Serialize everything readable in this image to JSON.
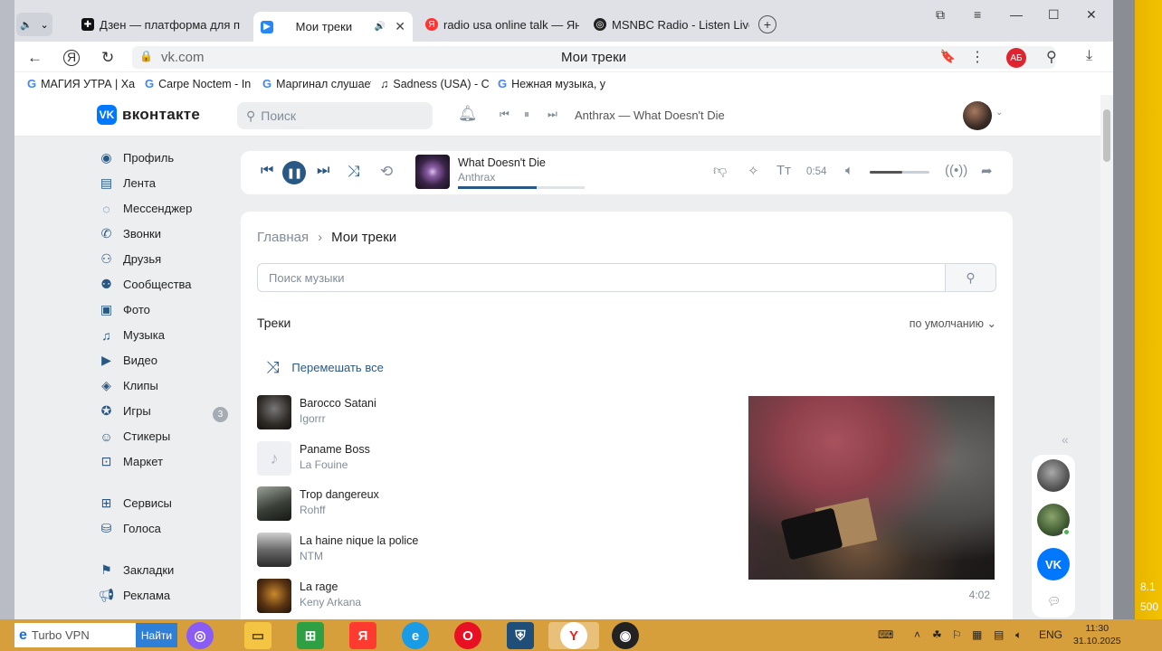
{
  "browser": {
    "tabs": [
      {
        "label": "Дзен — платформа для п",
        "icon": "dzen-icon"
      },
      {
        "label": "Мои треки",
        "icon": "vk-video-icon",
        "active": true
      },
      {
        "label": "radio usa online talk — Янд",
        "icon": "yandex-icon"
      },
      {
        "label": "MSNBC Radio - Listen Live",
        "icon": "msnbc-icon"
      }
    ],
    "url": "vk.com",
    "page_title": "Мои треки",
    "profile_badge": "АБ",
    "bookmarks": [
      "МАГИЯ УТРА | Ха",
      "Carpe Noctem - In",
      "Маргинал слушает",
      "Sadness (USA) - C",
      "Нежная музыка, у"
    ]
  },
  "vk": {
    "logo": "вконтакте",
    "search_placeholder": "Поиск",
    "header_track": "Anthrax — What Doesn't Die",
    "sidebar": [
      {
        "label": "Профиль",
        "icon": "profile-icon"
      },
      {
        "label": "Лента",
        "icon": "feed-icon"
      },
      {
        "label": "Мессенджер",
        "icon": "messenger-icon"
      },
      {
        "label": "Звонки",
        "icon": "phone-icon"
      },
      {
        "label": "Друзья",
        "icon": "friends-icon"
      },
      {
        "label": "Сообщества",
        "icon": "communities-icon"
      },
      {
        "label": "Фото",
        "icon": "photo-icon"
      },
      {
        "label": "Музыка",
        "icon": "music-icon"
      },
      {
        "label": "Видео",
        "icon": "video-icon"
      },
      {
        "label": "Клипы",
        "icon": "clips-icon"
      },
      {
        "label": "Игры",
        "icon": "games-icon"
      },
      {
        "label": "Стикеры",
        "icon": "stickers-icon"
      },
      {
        "label": "Маркет",
        "icon": "market-icon"
      },
      {
        "label": "Сервисы",
        "icon": "services-icon"
      },
      {
        "label": "Голоса",
        "icon": "voices-icon"
      },
      {
        "label": "Закладки",
        "icon": "bookmark-icon"
      },
      {
        "label": "Реклама",
        "icon": "ads-icon"
      }
    ],
    "games_badge": "3",
    "player": {
      "title": "What Doesn't Die",
      "artist": "Anthrax",
      "time": "0:54",
      "progress": 0.62,
      "volume": 0.55
    },
    "breadcrumb": {
      "home": "Главная",
      "current": "Мои треки"
    },
    "music_search_placeholder": "Поиск музыки",
    "section_title": "Треки",
    "sort_label": "по умолчанию",
    "shuffle_label": "Перемешать все",
    "tracks": [
      {
        "title": "Barocco Satani",
        "artist": "Igorrr"
      },
      {
        "title": "Paname Boss",
        "artist": "La Fouine"
      },
      {
        "title": "Trop dangereux",
        "artist": "Rohff"
      },
      {
        "title": "La haine nique la police",
        "artist": "NTM"
      },
      {
        "title": "La rage",
        "artist": "Keny Arkana"
      }
    ],
    "duration_visible": "4:02"
  },
  "taskbar": {
    "search_text": "Turbo VPN",
    "search_button": "Найти",
    "lang": "ENG",
    "time": "11:30",
    "date": "31.10.2025"
  },
  "edge_text": [
    "8.1",
    "500"
  ]
}
